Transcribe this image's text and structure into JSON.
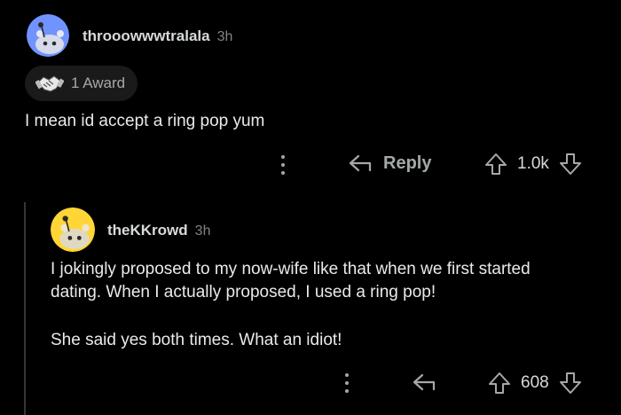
{
  "comment": {
    "username": "throoowwwtralala",
    "time": "3h",
    "award_label": "1 Award",
    "text": "I mean id accept a ring pop yum",
    "reply_label": "Reply",
    "votes": "1.0k",
    "avatar_color": "#7193ff"
  },
  "reply": {
    "username": "theKKrowd",
    "time": "3h",
    "text_line1": "I jokingly proposed to my now-wife like that when we first started",
    "text_line2": "dating. When I actually proposed, I used a ring pop!",
    "text_line3": "She said yes both times. What an idiot!",
    "votes": "608",
    "avatar_color": "#ffd635"
  },
  "icons": [
    "award-handshake-icon",
    "more-options-icon",
    "reply-arrow-icon",
    "upvote-icon",
    "downvote-icon"
  ]
}
